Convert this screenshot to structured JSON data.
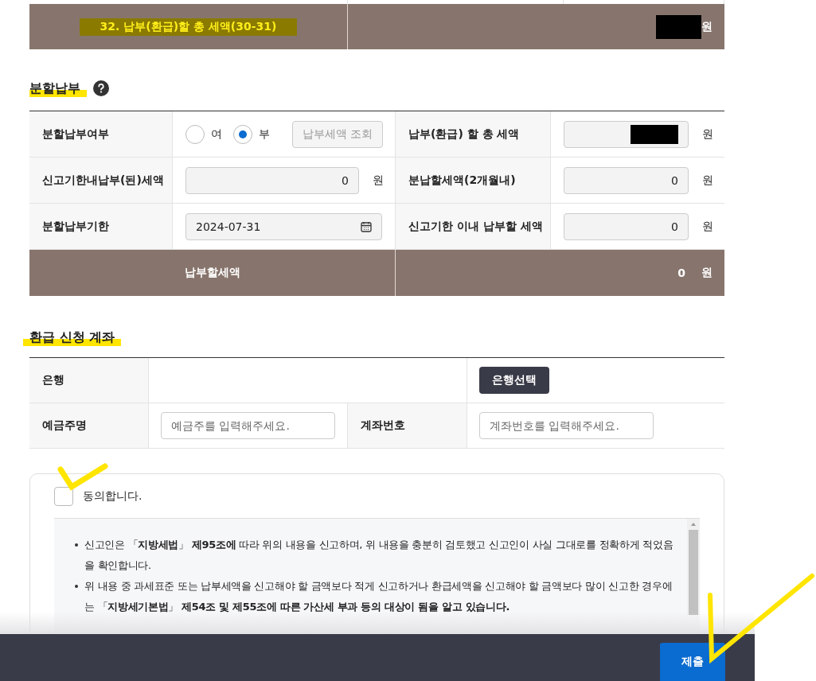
{
  "summary": {
    "label": "32. 납부(환급)할 총 세액(30-31)",
    "unit": "원"
  },
  "installment": {
    "title": "분할납부",
    "fields": [
      {
        "kind": "radio",
        "label": "분할납부여부",
        "options": [
          {
            "label": "여",
            "selected": false
          },
          {
            "label": "부",
            "selected": true
          }
        ],
        "button": {
          "label": "납부세액 조회",
          "disabled": true
        }
      },
      {
        "kind": "redacted",
        "label": "납부(환급) 할 총 세액",
        "unit": "원"
      },
      {
        "kind": "amount",
        "label": "신고기한내납부(된)세액",
        "value": "0",
        "unit": "원"
      },
      {
        "kind": "amount",
        "label": "분납할세액(2개월내)",
        "value": "0",
        "unit": "원"
      },
      {
        "kind": "date",
        "label": "분할납부기한",
        "value": "2024-07-31"
      },
      {
        "kind": "amount",
        "label": "신고기한 이내 납부할 세액",
        "value": "0",
        "unit": "원"
      }
    ],
    "total": {
      "label": "납부할세액",
      "value": "0",
      "unit": "원"
    }
  },
  "refund": {
    "title": "환급 신청 계좌",
    "bank": {
      "label": "은행",
      "button": "은행선택"
    },
    "holder": {
      "label": "예금주명",
      "placeholder": "예금주를 입력해주세요."
    },
    "account": {
      "label": "계좌번호",
      "placeholder": "계좌번호를 입력해주세요."
    }
  },
  "agreement": {
    "label": "동의합니다.",
    "checked": false,
    "items": [
      "신고인은 「**지방세법**」 **제95조에** 따라 위의 내용을 신고하며, 위 내용을 충분히 검토했고 신고인이 사실 그대로를 정확하게 적었음을 확인합니다.",
      "위 내용 중 과세표준 또는 납부세액을 신고해야 할 금액보다 적게 신고하거나 환급세액을 신고해야 할 금액보다 많이 신고한 경우에는 「**지방세기본법**」 **제54조 및 제55조에 따른 가산세 부과 등의 대상이 됨을 알고 있습니다.**"
    ]
  },
  "footer": {
    "submit": "제출"
  }
}
